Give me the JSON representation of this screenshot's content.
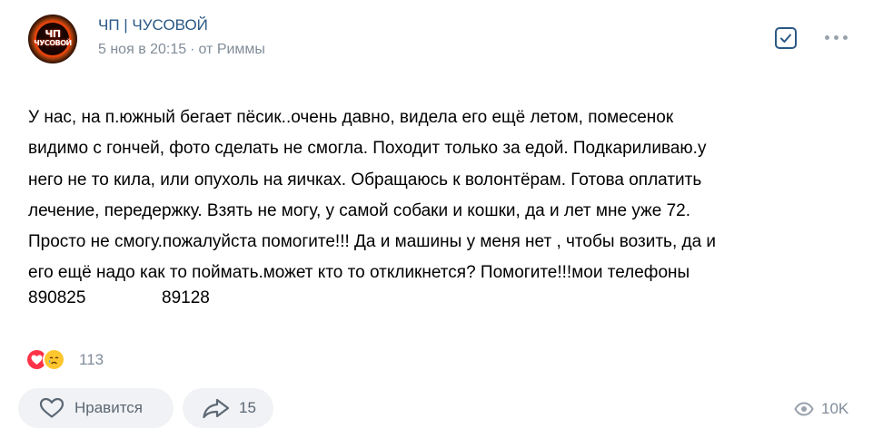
{
  "post": {
    "group_name": "ЧП | ЧУСОВОЙ",
    "avatar_text_line1": "ЧП",
    "avatar_text_line2": "ЧУСОВОЙ",
    "date": "5 ноя в 20:15",
    "separator": "·",
    "author": "от Риммы",
    "text_lines": [
      "У нас, на п.южный бегает пёсик..очень давно, видела его ещё летом, помесенок",
      "видимо с гончей, фото сделать не смогла. Походит только за едой. Подкариливаю.у",
      "него не то кила, или опухоль на яичках. Обращаюсь к волонтёрам. Готова оплатить",
      "лечение, передержку. Взять не могу, у самой собаки и кошки, да и лет мне уже 72.",
      "Просто не смогу.пожалуйста помогите!!! Да и машины у меня нет , чтобы возить, да и",
      "его ещё надо как то поймать.может кто то откликнется? Помогите!!!мои телефоны"
    ],
    "phone_1": "890825",
    "phone_2": "89128"
  },
  "reactions": {
    "icons": [
      "heart-reaction-icon",
      "crying-face-reaction-icon"
    ],
    "count": "113"
  },
  "actions": {
    "like_label": "Нравится",
    "share_count": "15",
    "views_count": "10K"
  },
  "colors": {
    "link": "#2a5885",
    "meta": "#818c99",
    "button_bg": "#f0f2f5",
    "button_text": "#5c6773",
    "heart": "#ff3347",
    "emoji": "#ffc62e"
  }
}
